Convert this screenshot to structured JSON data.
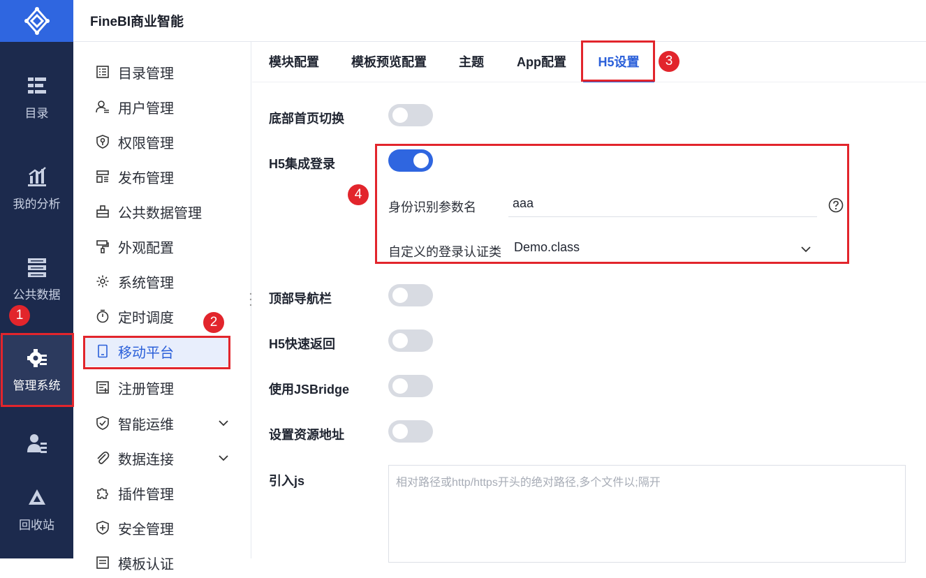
{
  "app": {
    "title": "FineBI商业智能"
  },
  "rail": {
    "items": [
      {
        "label": "目录",
        "icon": "catalog-icon"
      },
      {
        "label": "我的分析",
        "icon": "analysis-icon"
      },
      {
        "label": "公共数据",
        "icon": "public-data-icon"
      },
      {
        "label": "管理系统",
        "icon": "gear-icon",
        "active": true
      },
      {
        "label": "",
        "icon": "user-admin-icon"
      },
      {
        "label": "回收站",
        "icon": "recycle-icon"
      }
    ]
  },
  "menu": {
    "items": [
      {
        "label": "目录管理",
        "icon": "list-icon"
      },
      {
        "label": "用户管理",
        "icon": "user-icon"
      },
      {
        "label": "权限管理",
        "icon": "shield-key-icon"
      },
      {
        "label": "发布管理",
        "icon": "publish-icon"
      },
      {
        "label": "公共数据管理",
        "icon": "public-data-icon"
      },
      {
        "label": "外观配置",
        "icon": "paint-roller-icon"
      },
      {
        "label": "系统管理",
        "icon": "gear-icon"
      },
      {
        "label": "定时调度",
        "icon": "stopwatch-icon"
      },
      {
        "label": "移动平台",
        "icon": "mobile-icon",
        "active": true
      },
      {
        "label": "注册管理",
        "icon": "register-icon"
      },
      {
        "label": "智能运维",
        "icon": "ops-icon",
        "expandable": true
      },
      {
        "label": "数据连接",
        "icon": "paperclip-icon",
        "expandable": true
      },
      {
        "label": "插件管理",
        "icon": "puzzle-icon"
      },
      {
        "label": "安全管理",
        "icon": "shield-plus-icon"
      },
      {
        "label": "模板认证",
        "icon": "template-icon"
      }
    ]
  },
  "tabs": [
    {
      "label": "模块配置"
    },
    {
      "label": "模板预览配置"
    },
    {
      "label": "主题"
    },
    {
      "label": "App配置"
    },
    {
      "label": "H5设置",
      "active": true
    }
  ],
  "settings": {
    "bottom_home_switch": {
      "label": "底部首页切换",
      "on": false
    },
    "h5_sso": {
      "label": "H5集成登录",
      "on": true,
      "id_param": {
        "label": "身份识别参数名",
        "value": "aaa"
      },
      "auth_class": {
        "label": "自定义的登录认证类",
        "value": "Demo.class"
      }
    },
    "top_nav": {
      "label": "顶部导航栏",
      "on": false
    },
    "h5_quick_back": {
      "label": "H5快速返回",
      "on": false
    },
    "use_jsbridge": {
      "label": "使用JSBridge",
      "on": false
    },
    "resource_addr": {
      "label": "设置资源地址",
      "on": false
    },
    "include_js": {
      "label": "引入js",
      "placeholder": "相对路径或http/https开头的绝对路径,多个文件以;隔开"
    }
  },
  "annotations": {
    "b1": "1",
    "b2": "2",
    "b3": "3",
    "b4": "4"
  },
  "colors": {
    "accent": "#2f66e0",
    "rail_bg": "#1c2a4d",
    "annotation": "#e2252c"
  }
}
